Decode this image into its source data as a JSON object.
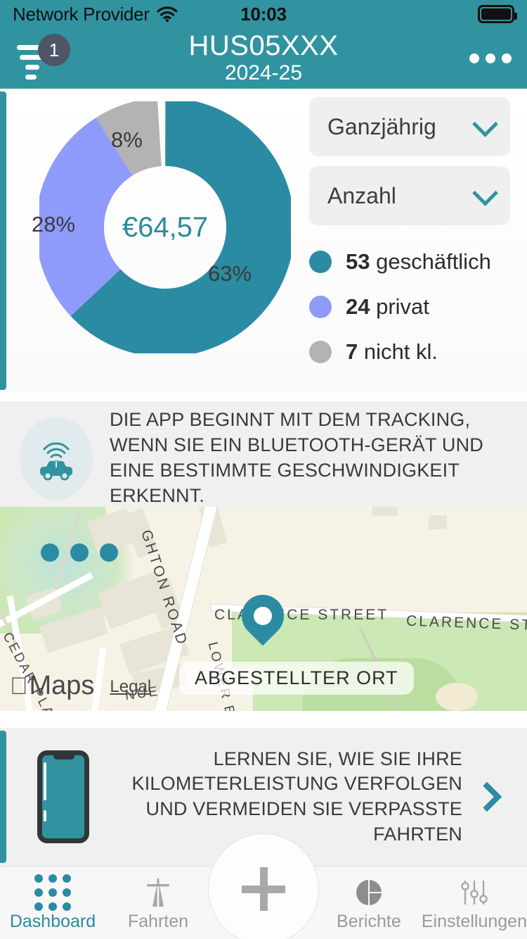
{
  "status_bar": {
    "carrier": "Network Provider",
    "wifi_icon": "wifi-icon",
    "time": "10:03",
    "battery_icon": "battery-full-icon"
  },
  "header": {
    "filter_icon": "filter-icon",
    "filter_badge_count": "1",
    "title": "HUS05XXX",
    "subtitle": "2024-25",
    "more_icon": "more-horizontal-icon"
  },
  "chart_card": {
    "center_value": "€64,57",
    "filters": [
      {
        "label": "Ganzjährig",
        "chevron_icon": "chevron-down-icon"
      },
      {
        "label": "Anzahl",
        "chevron_icon": "chevron-down-icon"
      }
    ],
    "legend": [
      {
        "count": "53",
        "label": "geschäftlich",
        "color": "#2b8ba3"
      },
      {
        "count": "24",
        "label": "privat",
        "color": "#8e9bfb"
      },
      {
        "count": "7",
        "label": "nicht kl.",
        "color": "#b3b3b3"
      }
    ]
  },
  "chart_data": {
    "type": "pie",
    "title": "",
    "categories": [
      "geschäftlich",
      "privat",
      "nicht kl."
    ],
    "values": [
      63,
      28,
      8
    ],
    "counts": [
      53,
      24,
      7
    ],
    "colors": [
      "#2b8ba3",
      "#8e9bfb",
      "#b3b3b3"
    ],
    "data_labels": [
      "63%",
      "28%",
      "8%"
    ],
    "center_label": "€64,57",
    "donut": true,
    "legend_position": "right"
  },
  "tracking_card": {
    "icon": "car-bluetooth-icon",
    "text": "DIE APP BEGINNT MIT DEM TRACKING, WENN SIE EIN BLUETOOTH-GERÄT UND EINE BESTIMMTE GESCHWINDIGKEIT ERKENNT."
  },
  "map": {
    "pin_icon": "map-pin-icon",
    "parked_label": "ABGESTELLTER ORT",
    "street_labels": [
      "GHTON ROAD",
      "CLARENCE STREET",
      "CLARENCE STREET",
      "CEDAR PLACE",
      "LOWER B",
      "NUE"
    ],
    "attribution": "Maps",
    "apple_glyph": "",
    "legal_link": "Legal",
    "dots_icon": "more-horizontal-icon"
  },
  "promo_card": {
    "phone_icon": "smartphone-icon",
    "text": "LERNEN SIE, WIE SIE IHRE KILOMETERLEISTUNG VERFOLGEN UND VERMEIDEN SIE VERPASSTE FAHRTEN",
    "chevron_icon": "chevron-right-icon"
  },
  "fab": {
    "icon": "plus-icon",
    "label": "+"
  },
  "tabbar": {
    "items": [
      {
        "label": "Dashboard",
        "icon": "dashboard-grid-icon",
        "active": true
      },
      {
        "label": "Fahrten",
        "icon": "highway-icon",
        "active": false
      },
      {
        "label": "Berichte",
        "icon": "pie-chart-icon",
        "active": false
      },
      {
        "label": "Einstellungen",
        "icon": "sliders-icon",
        "active": false
      }
    ]
  },
  "colors": {
    "brand_teal": "#3293a0",
    "accent_teal": "#2b8ba3",
    "purple": "#8e9bfb",
    "gray": "#b3b3b3",
    "card_bg": "#f0f0f0"
  }
}
